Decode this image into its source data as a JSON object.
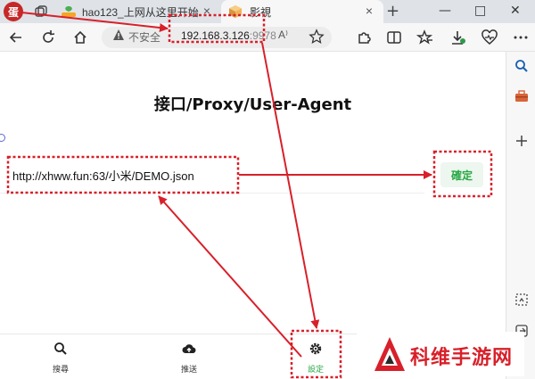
{
  "browser": {
    "avatar_text": "蛋",
    "tabs": [
      {
        "label": "hao123_上网从这里开始"
      },
      {
        "label": "影視"
      }
    ],
    "new_tab_symbol": "+",
    "close_symbol": "×",
    "window_controls": [
      "—",
      "□",
      "✕"
    ],
    "security_label": "不安全",
    "url_host": "192.168.3.126",
    "url_port": ":9978",
    "read_aloud_glyph": "A⁾"
  },
  "page": {
    "title": "接口/Proxy/User-Agent",
    "url_input_value": "http://xhww.fun:63/小米/DEMO.json",
    "confirm_label": "確定"
  },
  "bottom_nav": {
    "items": [
      {
        "label": "搜尋",
        "icon": "search-icon"
      },
      {
        "label": "推送",
        "icon": "cloud-upload-icon"
      },
      {
        "label": "設定",
        "icon": "gear-icon",
        "active": true
      }
    ]
  },
  "watermark": {
    "text": "科维手游网"
  },
  "colors": {
    "accent_green": "#27a844",
    "annotation_red": "#d8202a"
  }
}
